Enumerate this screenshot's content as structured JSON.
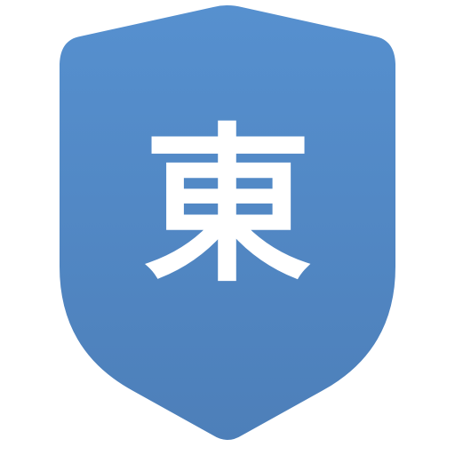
{
  "emblem": {
    "icon": "shield-icon",
    "character": "東",
    "colors": {
      "gradient_top": "#5690cf",
      "gradient_bottom": "#4d7fb9",
      "glyph": "#ffffff",
      "background": "#ffffff"
    }
  }
}
